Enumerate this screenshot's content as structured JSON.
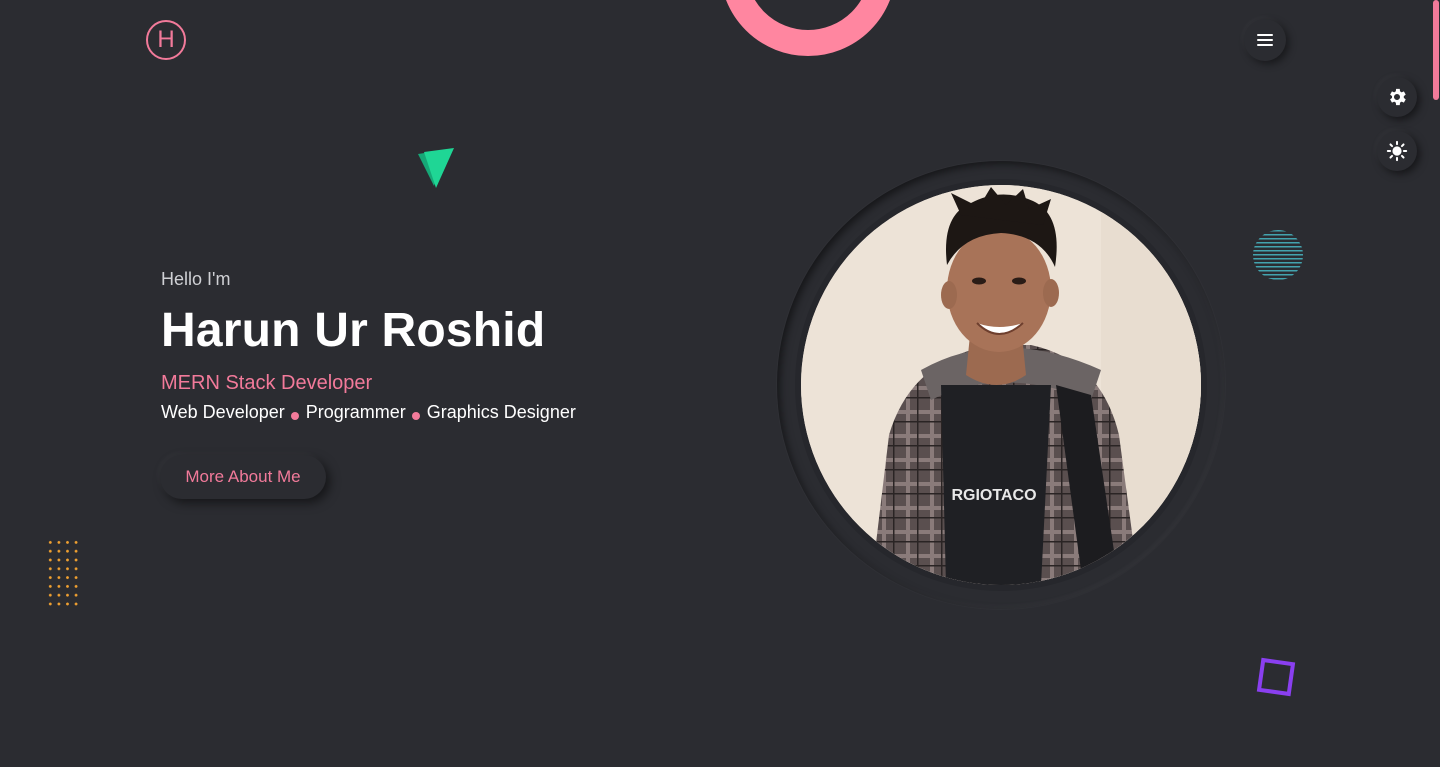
{
  "header": {
    "logo_letter": "H",
    "menu_icon": "hamburger-menu-icon"
  },
  "side_controls": {
    "settings_icon": "gear-icon",
    "theme_icon": "sun-icon"
  },
  "hero": {
    "greeting": "Hello I'm",
    "name": "Harun Ur Roshid",
    "role": "MERN Stack Developer",
    "skills": [
      "Web Developer",
      "Programmer",
      "Graphics Designer"
    ],
    "cta_label": "More About Me"
  },
  "photo": {
    "shirt_text": "RGIOTACO"
  },
  "colors": {
    "background": "#2b2c31",
    "accent_pink": "#f27a9a",
    "ring_pink": "#ff86a0",
    "triangle_green": "#1fcf8f",
    "stripe_cyan": "#47b8c4",
    "square_purple": "#8a3ff0",
    "dots_orange": "#f0a030"
  }
}
